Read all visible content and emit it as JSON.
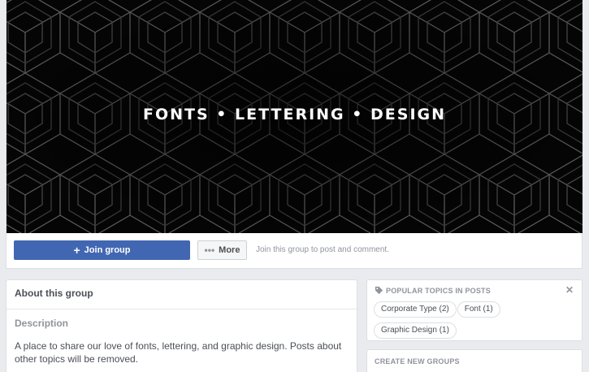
{
  "cover": {
    "title": "FONTS • LETTERING • DESIGN"
  },
  "actions": {
    "join_label": "Join group",
    "more_label": "More",
    "join_hint": "Join this group to post and comment."
  },
  "about": {
    "title": "About this group",
    "description_heading": "Description",
    "description_text": "A place to share our love of fonts, lettering, and graphic design. Posts about other topics will be removed."
  },
  "popular_topics": {
    "title": "POPULAR TOPICS IN POSTS",
    "close_symbol": "✕",
    "topics": [
      {
        "label": "Corporate Type (2)"
      },
      {
        "label": "Font (1)"
      },
      {
        "label": "Graphic Design (1)"
      }
    ]
  },
  "create_groups": {
    "title": "CREATE NEW GROUPS"
  },
  "colors": {
    "brand_blue": "#4267b2",
    "page_bg": "#e9ebee",
    "muted_text": "#90949c",
    "body_text": "#4b4f56"
  },
  "icons": {
    "tag": "tag-icon",
    "plus": "plus-icon",
    "more": "more-dots-icon",
    "close": "close-icon"
  }
}
